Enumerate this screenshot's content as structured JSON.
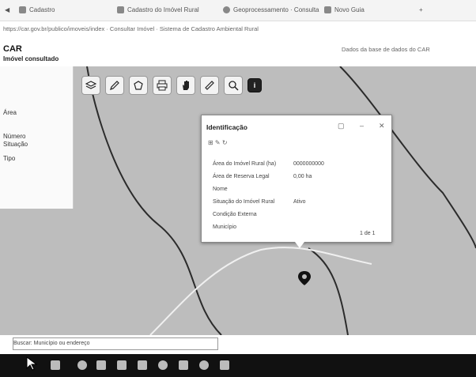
{
  "browser": {
    "tabs": [
      {
        "label": "Cadastro",
        "icon": "page-icon"
      },
      {
        "label": "Cadastro do Imóvel Rural",
        "icon": "page-icon"
      },
      {
        "label": "Geoprocessamento · Consulta",
        "icon": "globe-icon"
      },
      {
        "label": "Novo Guia",
        "icon": "page-icon"
      }
    ],
    "address": "https://car.gov.br/publico/imoveis/index · Consultar Imóvel · Sistema de Cadastro Ambiental Rural"
  },
  "page": {
    "title": "CAR",
    "subtitle": "Imóvel consultado",
    "topright": "Dados da base de dados do CAR"
  },
  "left_panel": {
    "items": [
      "Área",
      "Número",
      "Situação",
      "Tipo"
    ]
  },
  "toolbar": {
    "tools": [
      {
        "name": "layers-tool",
        "icon": "layers-icon"
      },
      {
        "name": "draw-tool",
        "icon": "pencil-icon"
      },
      {
        "name": "polygon-tool",
        "icon": "polygon-icon"
      },
      {
        "name": "print-tool",
        "icon": "print-icon"
      },
      {
        "name": "pan-tool",
        "icon": "hand-icon"
      },
      {
        "name": "measure-tool",
        "icon": "ruler-icon"
      },
      {
        "name": "zoom-tool",
        "icon": "magnifier-icon"
      },
      {
        "name": "info-tool",
        "icon": "info-icon"
      }
    ]
  },
  "popup": {
    "title": "Identificação",
    "fields": [
      {
        "label": "Área do Imóvel Rural (ha)",
        "value": "0000000000"
      },
      {
        "label": "Área de Reserva Legal",
        "value": "0,00 ha"
      },
      {
        "label": "Nome",
        "value": ""
      },
      {
        "label": "Situação do Imóvel Rural",
        "value": "Ativo"
      },
      {
        "label": "Condição Externa",
        "value": ""
      },
      {
        "label": "Município",
        "value": ""
      }
    ],
    "page_counter": "1 de 1"
  },
  "search_bar": {
    "text": "Buscar: Município ou endereço"
  },
  "colors": {
    "map_bg": "#bdbdbd",
    "taskbar": "#111111",
    "popup_bg": "#ffffff",
    "boundary": "#2b2b2b",
    "route": "#f0f0f0"
  }
}
